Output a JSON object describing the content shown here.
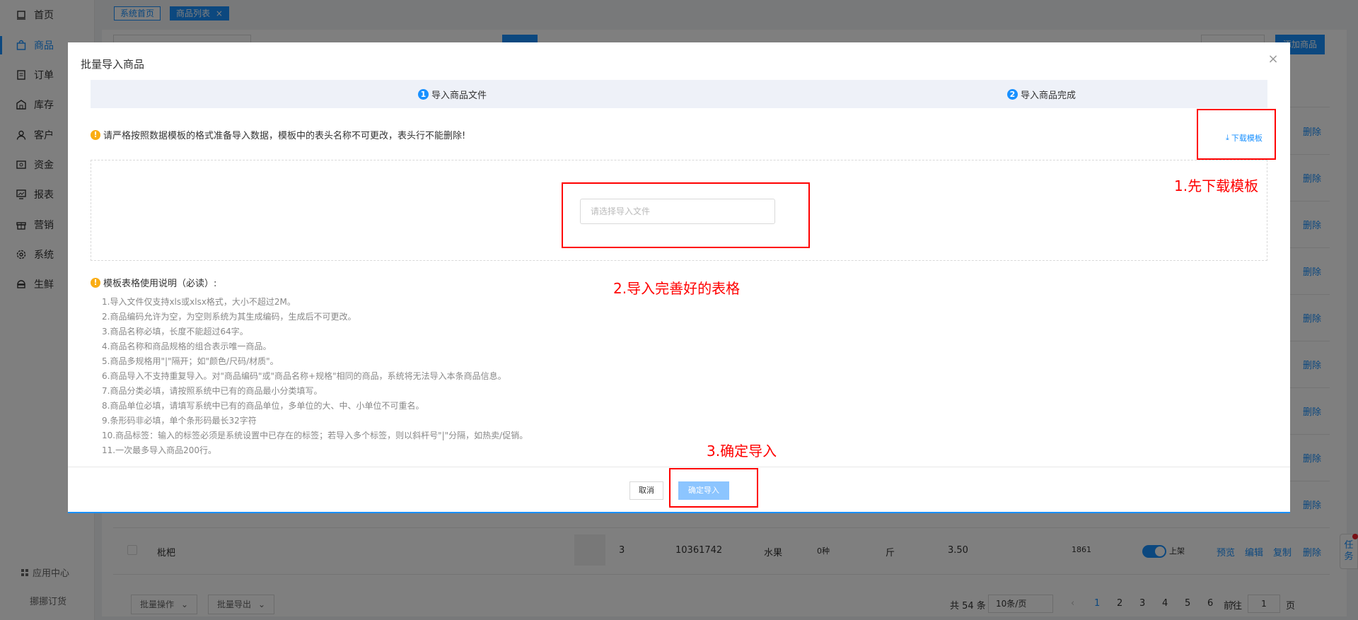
{
  "sidebar": {
    "items": [
      {
        "label": "首页",
        "icon": "home-icon"
      },
      {
        "label": "商品",
        "icon": "bag-icon"
      },
      {
        "label": "订单",
        "icon": "document-icon"
      },
      {
        "label": "库存",
        "icon": "warehouse-icon"
      },
      {
        "label": "客户",
        "icon": "user-icon"
      },
      {
        "label": "资金",
        "icon": "wallet-icon"
      },
      {
        "label": "报表",
        "icon": "report-icon"
      },
      {
        "label": "营销",
        "icon": "gift-icon"
      },
      {
        "label": "系统",
        "icon": "gear-icon"
      },
      {
        "label": "生鲜",
        "icon": "fresh-icon"
      }
    ],
    "app_center": "应用中心",
    "sub_order": "挪挪订货"
  },
  "tabs": {
    "home": "系统首页",
    "current": "商品列表",
    "close": "×"
  },
  "background": {
    "add_label": "添加商品",
    "delete_label": "删除",
    "row": {
      "name": "枇杷",
      "stock": "3",
      "code": "10361742",
      "category": "水果",
      "spec": "0种",
      "unit": "斤",
      "price": "3.50",
      "sales": "1861",
      "status": "上架",
      "actions": [
        "预览",
        "编辑",
        "复制",
        "删除"
      ]
    },
    "footer": {
      "batch_ops": "批量操作",
      "batch_export": "批量导出",
      "total": "共 54 条",
      "per_page": "10条/页",
      "pages": [
        "1",
        "2",
        "3",
        "4",
        "5",
        "6"
      ],
      "prev": "‹",
      "next": "›",
      "goto_label": "前往",
      "goto_value": "1",
      "page_unit": "页"
    },
    "task_label": "任务"
  },
  "modal": {
    "title": "批量导入商品",
    "close": "×",
    "steps": [
      {
        "num": "1",
        "label": "导入商品文件"
      },
      {
        "num": "2",
        "label": "导入商品完成"
      }
    ],
    "warning": "请严格按照数据模板的格式准备导入数据，模板中的表头名称不可更改，表头行不能删除!",
    "download_label": "下载模板",
    "upload_placeholder": "请选择导入文件",
    "notes_title": "模板表格使用说明（必读）:",
    "notes": [
      "1.导入文件仅支持xls或xlsx格式，大小不超过2M。",
      "2.商品编码允许为空，为空则系统为其生成编码，生成后不可更改。",
      "3.商品名称必填，长度不能超过64字。",
      "4.商品名称和商品规格的组合表示唯一商品。",
      "5.商品多规格用\"|\"隔开；如\"颜色/尺码/材质\"。",
      "6.商品导入不支持重复导入。对\"商品编码\"或\"商品名称+规格\"相同的商品，系统将无法导入本条商品信息。",
      "7.商品分类必填，请按照系统中已有的商品最小分类填写。",
      "8.商品单位必填，请填写系统中已有的商品单位，多单位的大、中、小单位不可重名。",
      "9.条形码非必填，单个条形码最长32字符",
      "10.商品标签：输入的标签必须是系统设置中已存在的标签；若导入多个标签，则以斜杆号\"|\"分隔，如热卖/促销。",
      "11.一次最多导入商品200行。"
    ],
    "cancel_label": "取消",
    "confirm_label": "确定导入"
  },
  "annotations": {
    "step1": "1.先下载模板",
    "step2": "2.导入完善好的表格",
    "step3": "3.确定导入"
  },
  "colors": {
    "primary": "#1890ff",
    "annotation": "#ff0000",
    "warning": "#faad14"
  }
}
